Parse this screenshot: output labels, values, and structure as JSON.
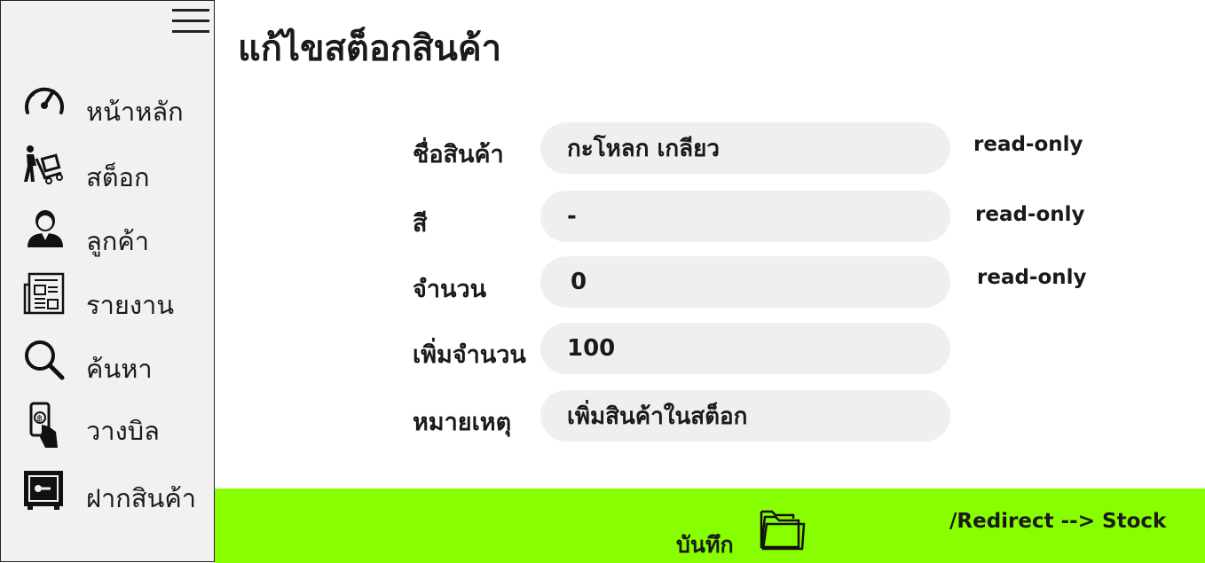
{
  "sidebar": {
    "items": [
      {
        "label": "หน้าหลัก",
        "icon": "speedometer-icon"
      },
      {
        "label": "สต็อก",
        "icon": "hand-truck-icon"
      },
      {
        "label": "ลูกค้า",
        "icon": "user-icon"
      },
      {
        "label": "รายงาน",
        "icon": "newspaper-icon"
      },
      {
        "label": "ค้นหา",
        "icon": "search-icon"
      },
      {
        "label": "วางบิล",
        "icon": "bill-payment-icon"
      },
      {
        "label": "ฝากสินค้า",
        "icon": "safe-icon"
      }
    ]
  },
  "main": {
    "title": "แก้ไขสต็อกสินค้า",
    "fields": [
      {
        "label": "ชื่อสินค้า",
        "value": "กะโหลก เกลียว",
        "note": "read-only"
      },
      {
        "label": "สี",
        "value": "-",
        "note": "read-only"
      },
      {
        "label": "จำนวน",
        "value": "0",
        "note": "read-only"
      },
      {
        "label": "เพิ่มจำนวน",
        "value": "100"
      },
      {
        "label": "หมายเหตุ",
        "value": "เพิ่มสินค้าในสต็อก"
      }
    ]
  },
  "footer": {
    "save_label": "บันทึก",
    "redirect_note": "/Redirect --> Stock",
    "background_color": "#88ff00"
  }
}
